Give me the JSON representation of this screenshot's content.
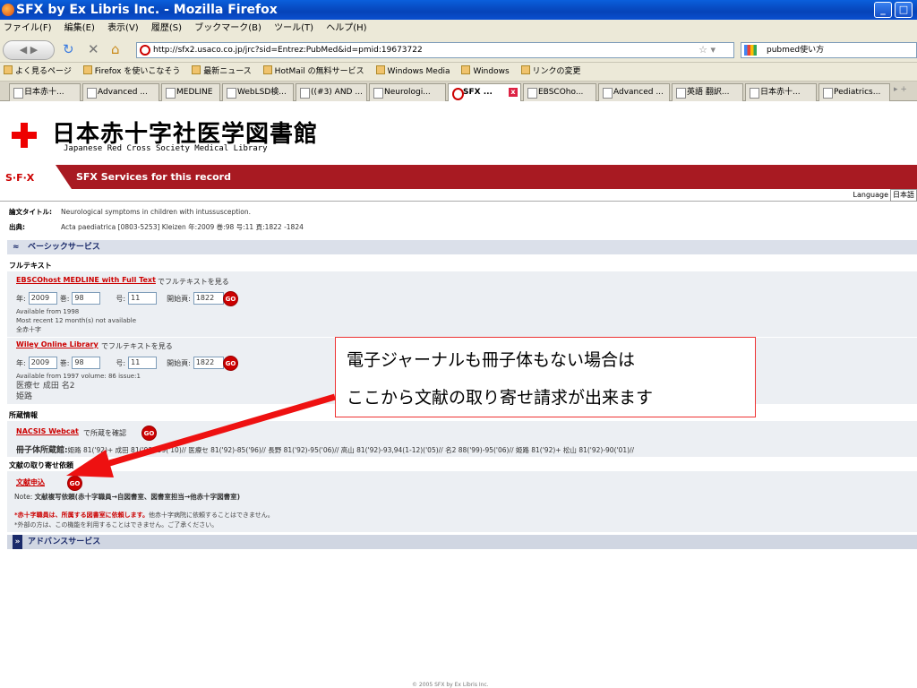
{
  "window": {
    "title": "SFX by Ex Libris Inc. - Mozilla Firefox"
  },
  "menu": [
    "ファイル(F)",
    "編集(E)",
    "表示(V)",
    "履歴(S)",
    "ブックマーク(B)",
    "ツール(T)",
    "ヘルプ(H)"
  ],
  "nav": {
    "url": "http://sfx2.usaco.co.jp/jrc?sid=Entrez:PubMed&id=pmid:19673722",
    "search_value": "pubmed使い方"
  },
  "bookmarks": [
    "よく見るページ",
    "Firefox を使いこなそう",
    "最新ニュース",
    "HotMail の無料サービス",
    "Windows Media",
    "Windows",
    "リンクの変更"
  ],
  "tabs": [
    "日本赤十...",
    "Advanced ...",
    "MEDLINE",
    "WebLSD検...",
    "((#3) AND ...",
    "Neurologi...",
    "SFX ...",
    "EBSCOho...",
    "Advanced ...",
    "英語 翻訳...",
    "日本赤十...",
    "Pediatrics..."
  ],
  "header": {
    "library_title": "日本赤十字社医学図書館",
    "library_subtitle": "Japanese Red Cross Society Medical Library"
  },
  "sfx": {
    "logo": "S·F·X",
    "heading": "SFX Services for this record",
    "language_label": "Language",
    "language_value": "日本語"
  },
  "record": {
    "title_label": "論文タイトル:",
    "title_value": "Neurological symptoms in children with intussusception.",
    "source_label": "出典:",
    "source_value": "Acta paediatrica [0803-5253] Kleizen 年:2009 巻:98 号:11 頁:1822 -1824"
  },
  "basic": {
    "header": "ベーシックサービス",
    "fulltext_label": "フルテキスト"
  },
  "fulltext1": {
    "link": "EBSCOhost MEDLINE with Full Text",
    "suffix": "でフルテキストを見る",
    "year_label": "年:",
    "year": "2009",
    "vol_label": "巻:",
    "vol": "98",
    "issue_label": "号:",
    "issue": "11",
    "page_label": "開始頁:",
    "page": "1822",
    "avail1": "Available from 1998",
    "avail2": "Most recent 12 month(s) not available",
    "avail3": "全赤十字"
  },
  "fulltext2": {
    "link": "Wiley Online Library",
    "suffix": "でフルテキストを見る",
    "year_label": "年:",
    "year": "2009",
    "vol_label": "巻:",
    "vol": "98",
    "issue_label": "号:",
    "issue": "11",
    "page_label": "開始頁:",
    "page": "1822",
    "avail1": "Available from 1997 volume: 86 issue:1",
    "avail2": "医療セ 成田 名2",
    "avail3": "姫路"
  },
  "holdings": {
    "header": "所蔵情報",
    "link": "NACSIS Webcat",
    "suffix": "で所蔵を確認",
    "label": "冊子体所蔵館:",
    "text": "姫路 81('92)+ 成田 81('93)-99('10)// 医療セ 81('92)-85('96)// 長野 81('92)-95('06)// 高山 81('92)-93,94(1-12)('05)// 名2 88('99)-95('06)// 姫路 81('92)+ 松山 81('92)-90('01)//"
  },
  "docdelivery": {
    "header": "文献の取り寄せ依頼",
    "link": "文献申込",
    "note_label": "Note:",
    "note": "文献複写依頼(赤十字職員→自図書室、図書室担当→他赤十字図書室)",
    "red": "*赤十字職員は、所属する図書室に依頼します。",
    "red_tail": "他赤十字病院に依頼することはできません。",
    "ext": "*外部の方は、この機能を利用することはできません。ご了承ください。"
  },
  "advanced": {
    "header": "アドバンスサービス"
  },
  "go_label": "GO",
  "callout": {
    "line1": "電子ジャーナルも冊子体もない場合は",
    "line2": "ここから文献の取り寄せ請求が出来ます"
  },
  "footer": "© 2005 SFX by Ex Libris Inc.",
  "colors": {
    "sfx_bar": "#a81a22",
    "link": "#cc0000",
    "section": "#dbe0ea",
    "arrow": "#ee1111"
  }
}
